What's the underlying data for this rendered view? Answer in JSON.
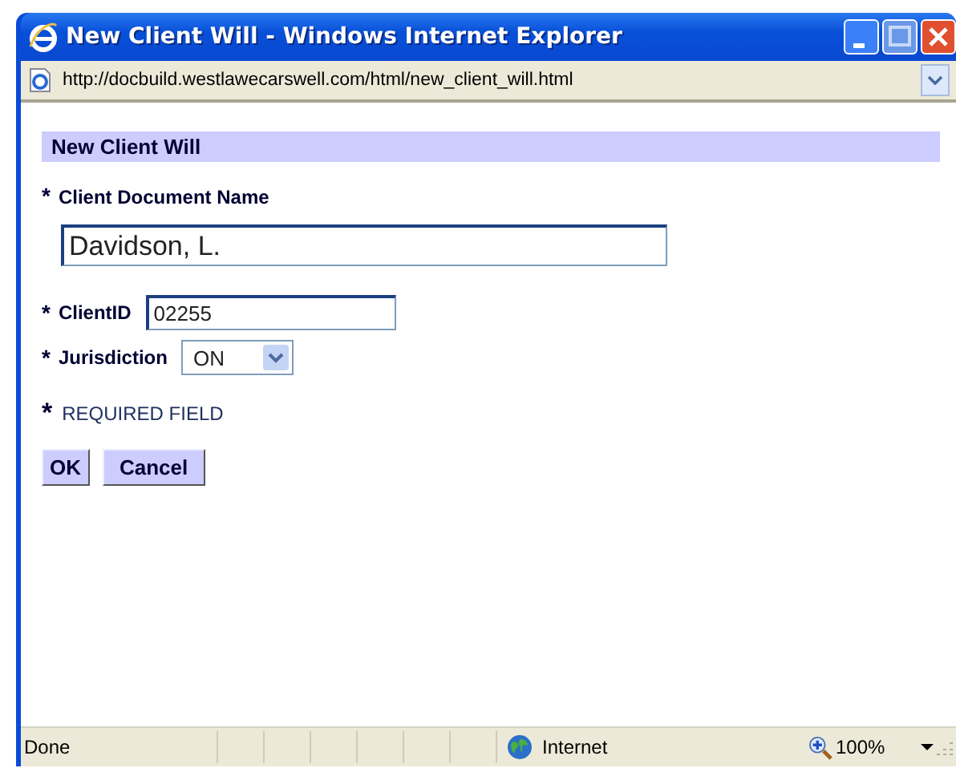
{
  "window": {
    "title": "New Client Will - Windows Internet Explorer"
  },
  "address_bar": {
    "url": "http://docbuild.westlawecarswell.com/html/new_client_will.html"
  },
  "form": {
    "heading": "New Client Will",
    "fields": [
      {
        "kind": "wide",
        "mark": "*",
        "label": "Client Document Name",
        "value": "Davidson, L."
      },
      {
        "kind": "text",
        "mark": "*",
        "label": "ClientID",
        "value": "02255"
      },
      {
        "kind": "select",
        "mark": "*",
        "label": "Jurisdiction",
        "value": "ON"
      }
    ],
    "required_note": {
      "mark": "*",
      "text": "REQUIRED FIELD"
    },
    "buttons": [
      "OK",
      "Cancel"
    ]
  },
  "status_bar": {
    "status": "Done",
    "zone": "Internet",
    "zoom": "100%"
  }
}
